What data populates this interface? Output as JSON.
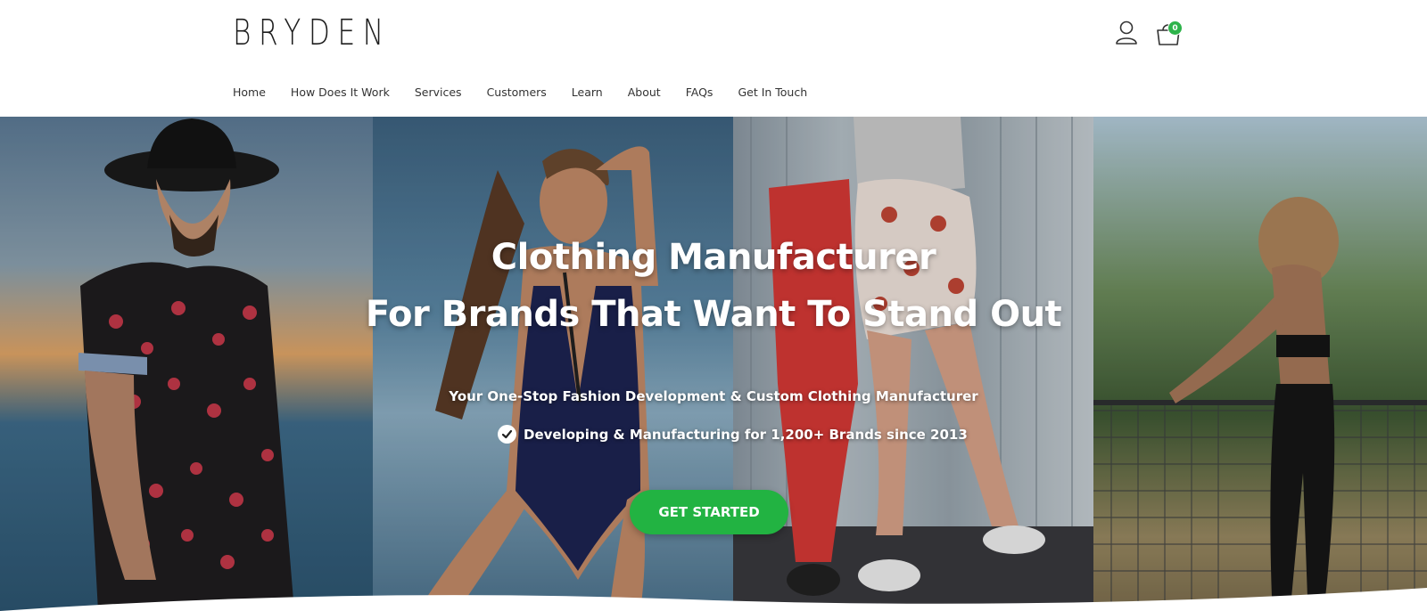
{
  "brand": {
    "logo_text": "BRYDEN"
  },
  "header": {
    "cart_count": "0",
    "icons": {
      "account": "user-icon",
      "cart": "shopping-bag-icon"
    }
  },
  "nav": {
    "items": [
      {
        "label": "Home"
      },
      {
        "label": "How Does It Work"
      },
      {
        "label": "Services"
      },
      {
        "label": "Customers"
      },
      {
        "label": "Learn"
      },
      {
        "label": "About"
      },
      {
        "label": "FAQs"
      },
      {
        "label": "Get In Touch"
      }
    ]
  },
  "hero": {
    "title_line1": "Clothing Manufacturer",
    "title_line2": "For Brands That Want To Stand Out",
    "subtitle": "Your One-Stop Fashion Development & Custom Clothing Manufacturer",
    "check_text": "Developing & Manufacturing for 1,200+ Brands since 2013",
    "cta_label": "GET STARTED"
  },
  "colors": {
    "accent": "#22b342",
    "badge": "#2db34a",
    "text": "#333333"
  }
}
